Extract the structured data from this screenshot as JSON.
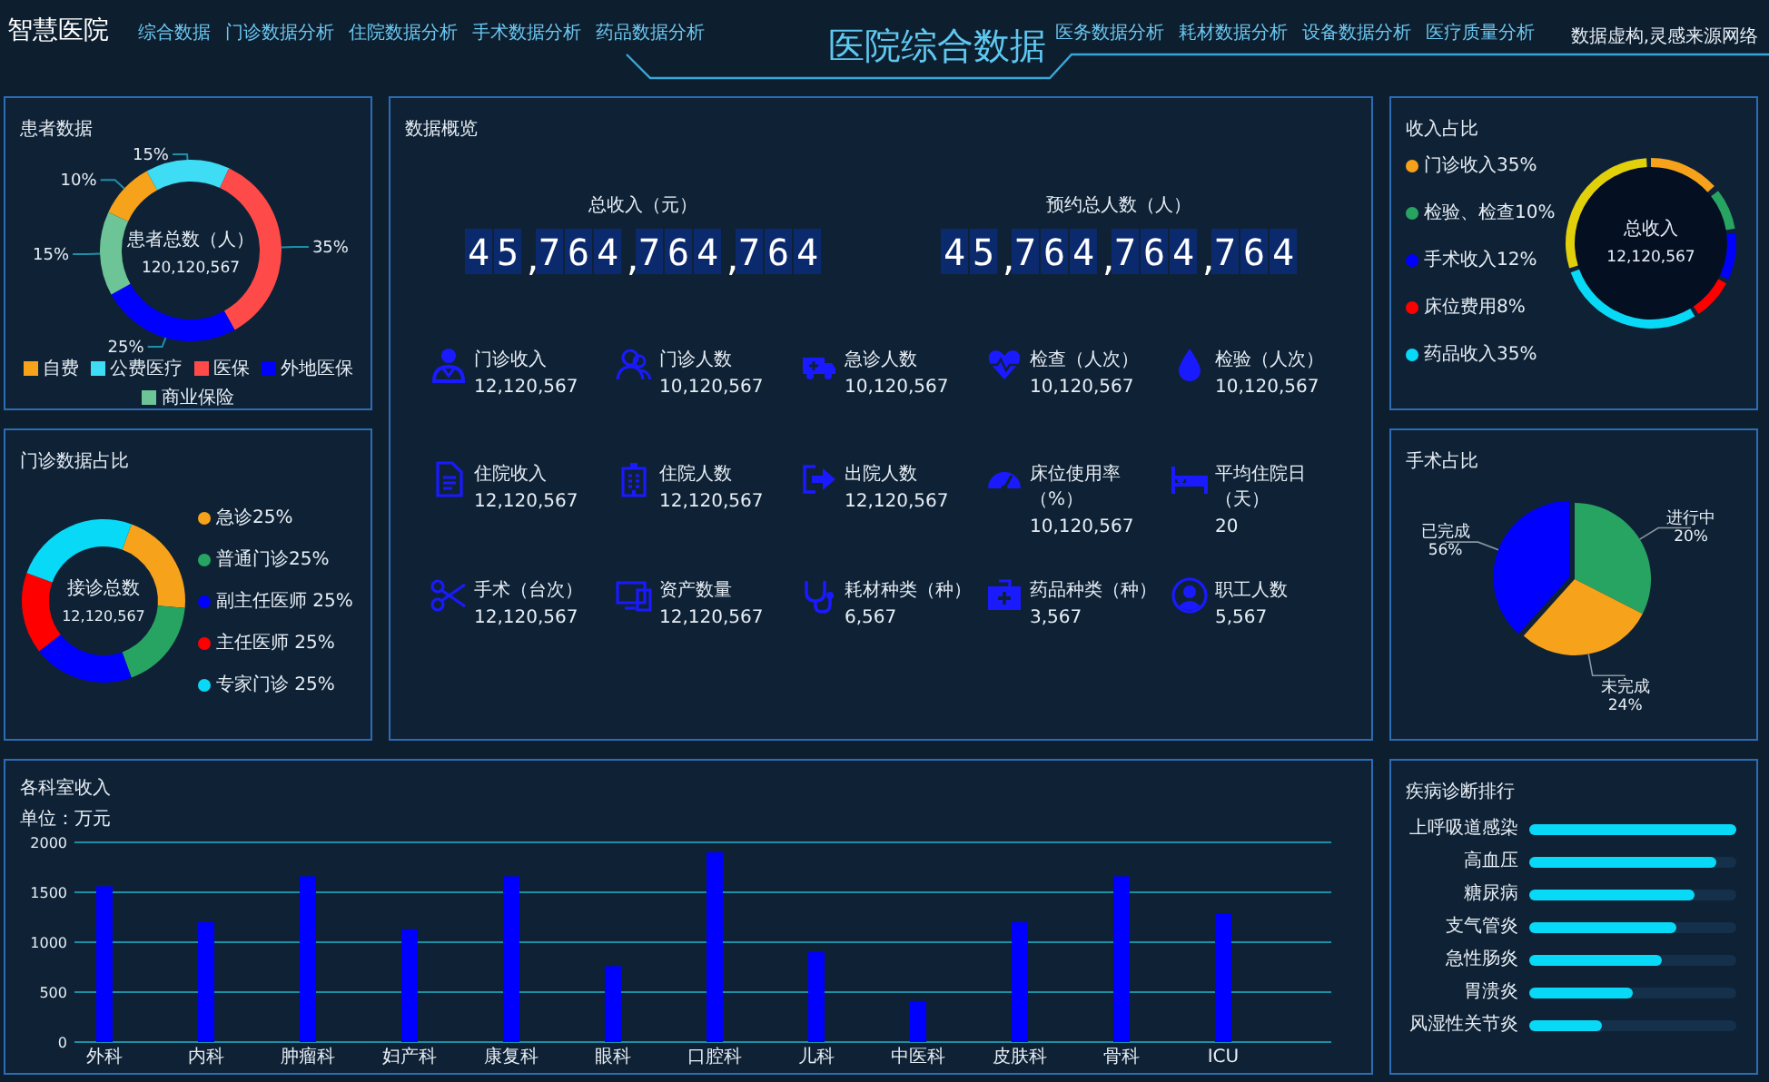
{
  "header": {
    "logo": "智慧医院",
    "nav_left": [
      {
        "label": "综合数据"
      },
      {
        "label": "门诊数据分析"
      },
      {
        "label": "住院数据分析"
      },
      {
        "label": "手术数据分析"
      },
      {
        "label": "药品数据分析"
      }
    ],
    "title": "医院综合数据",
    "nav_right": [
      {
        "label": "医务数据分析"
      },
      {
        "label": "耗材数据分析"
      },
      {
        "label": "设备数据分析"
      },
      {
        "label": "医疗质量分析"
      }
    ],
    "note": "数据虚构,灵感来源网络"
  },
  "patients": {
    "title": "患者数据",
    "center_label": "患者总数（人）",
    "center_value": "120,120,567",
    "chart_data": {
      "type": "donut",
      "categories": [
        "自费",
        "公费医疗",
        "医保",
        "外地医保",
        "商业保险"
      ],
      "values": [
        10,
        15,
        35,
        25,
        15
      ],
      "value_labels": [
        "10%",
        "15%",
        "35%",
        "25%",
        "15%"
      ]
    },
    "legend": [
      {
        "color": "#f7a21b"
      },
      {
        "color": "#3fdcf5"
      },
      {
        "color": "#ff4a4a"
      },
      {
        "color": "#0000ff"
      },
      {
        "color": "#6cc497"
      }
    ]
  },
  "outpatient": {
    "title": "门诊数据占比",
    "center_label": "接诊总数",
    "center_value": "12,120,567",
    "legend": [
      {
        "label": "急诊25%",
        "color": "#f7a21b"
      },
      {
        "label": "普通门诊25%",
        "color": "#27a462"
      },
      {
        "label": "副主任医师 25%",
        "color": "#0000ff"
      },
      {
        "label": "主任医师 25%",
        "color": "#ff0000"
      },
      {
        "label": "专家门诊 25%",
        "color": "#08d9f7"
      }
    ]
  },
  "overview": {
    "title": "数据概览",
    "counters": [
      {
        "label": "总收入（元）",
        "value": "45,764,764,764"
      },
      {
        "label": "预约总人数（人）",
        "value": "45,764,764,764"
      }
    ],
    "stats": [
      {
        "label": "门诊收入",
        "value": "12,120,567"
      },
      {
        "label": "门诊人数",
        "value": "10,120,567"
      },
      {
        "label": "急诊人数",
        "value": "10,120,567"
      },
      {
        "label": "检查（人次）",
        "value": "10,120,567"
      },
      {
        "label": "检验（人次）",
        "value": "10,120,567"
      },
      {
        "label": "住院收入",
        "value": "12,120,567"
      },
      {
        "label": "住院人数",
        "value": "12,120,567"
      },
      {
        "label": "出院人数",
        "value": "12,120,567"
      },
      {
        "label": "床位使用率（%）",
        "value": "10,120,567"
      },
      {
        "label": "平均住院日（天）",
        "value": "20"
      },
      {
        "label": "手术（台次）",
        "value": "12,120,567"
      },
      {
        "label": "资产数量",
        "value": "12,120,567"
      },
      {
        "label": "耗材种类（种）",
        "value": "6,567"
      },
      {
        "label": "药品种类（种）",
        "value": "3,567"
      },
      {
        "label": "职工人数",
        "value": "5,567"
      }
    ]
  },
  "income": {
    "title": "收入占比",
    "legend": [
      {
        "label": "门诊收入35%",
        "color": "#f7a21b"
      },
      {
        "label": "检验、检查10%",
        "color": "#27a462"
      },
      {
        "label": "手术收入12%",
        "color": "#0000ff"
      },
      {
        "label": "床位费用8%",
        "color": "#ff0000"
      },
      {
        "label": "药品收入35%",
        "color": "#08d9f7"
      }
    ],
    "center_label": "总收入",
    "center_value": "12,120,567"
  },
  "surgery": {
    "title": "手术占比",
    "slices": [
      {
        "label": "进行中",
        "value": "20%",
        "color": "#27a462"
      },
      {
        "label": "未完成",
        "value": "24%",
        "color": "#f7a21b"
      },
      {
        "label": "已完成",
        "value": "56%",
        "color": "#0000ff"
      }
    ]
  },
  "department": {
    "title": "各科室收入",
    "unit": "单位：万元",
    "chart_data": {
      "type": "bar",
      "categories": [
        "外科",
        "内科",
        "肿瘤科",
        "妇产科",
        "康复科",
        "眼科",
        "口腔科",
        "儿科",
        "中医科",
        "皮肤科",
        "骨科",
        "ICU"
      ],
      "series": [
        {
          "color": "#0000ff",
          "values": [
            1560,
            1200,
            1660,
            1130,
            1660,
            760,
            1900,
            900,
            410,
            1200,
            1660,
            1290
          ]
        }
      ],
      "ylim": [
        0,
        2000
      ],
      "yticks": [
        0,
        500,
        1000,
        1500,
        2000
      ],
      "grid": true
    }
  },
  "diseases": {
    "title": "疾病诊断排行",
    "items": [
      {
        "label": "上呼吸道感染",
        "level": 1.0
      },
      {
        "label": "高血压",
        "level": 0.9
      },
      {
        "label": "糖尿病",
        "level": 0.8
      },
      {
        "label": "支气管炎",
        "level": 0.71
      },
      {
        "label": "急性肠炎",
        "level": 0.64
      },
      {
        "label": "胃溃炎",
        "level": 0.5
      },
      {
        "label": "风湿性关节炎",
        "level": 0.35
      }
    ]
  }
}
